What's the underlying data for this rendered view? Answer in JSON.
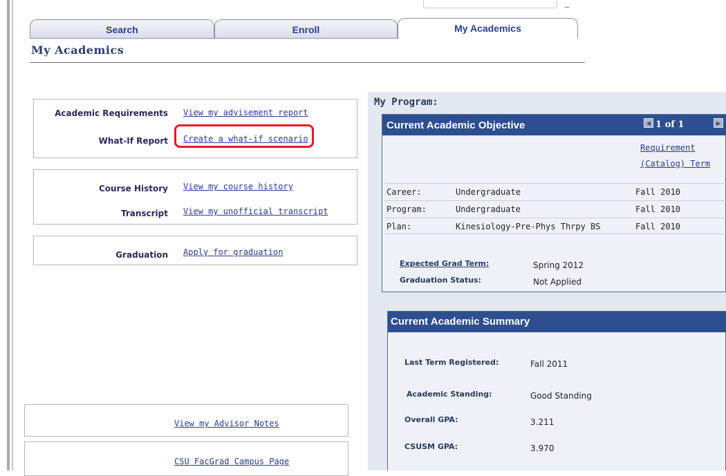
{
  "tabs": [
    {
      "label": "Search"
    },
    {
      "label": "Enroll"
    },
    {
      "label": "My Academics"
    }
  ],
  "page_title": "My Academics",
  "sections": {
    "academic_requirements": {
      "label": "Academic Requirements",
      "link": "View my advisement report"
    },
    "what_if": {
      "label": "What-If Report",
      "link": "Create a what-if scenario"
    },
    "course_history": {
      "label": "Course History",
      "link": "View my course history"
    },
    "transcript": {
      "label": "Transcript",
      "link": "View my unofficial transcript"
    },
    "graduation": {
      "label": "Graduation",
      "link": "Apply for graduation"
    }
  },
  "bottom_links": {
    "advisor_notes": "View my Advisor Notes",
    "campus_page": "CSU FacGrad Campus Page"
  },
  "program": {
    "title": "My Program:",
    "objective_header": "Current Academic Objective",
    "pager": "1 of 1",
    "req_term_line1": "Requirement",
    "req_term_line2": "(Catalog) Term",
    "rows": [
      {
        "label": "Career:",
        "value": "Undergraduate",
        "term": "Fall 2010"
      },
      {
        "label": "Program:",
        "value": "Undergraduate",
        "term": "Fall 2010"
      },
      {
        "label": "Plan:",
        "value": "Kinesiology-Pre-Phys Thrpy BS",
        "term": "Fall 2010"
      }
    ],
    "expected_grad_label": "Expected Grad Term:",
    "expected_grad_value": "Spring 2012",
    "grad_status_label": "Graduation Status:",
    "grad_status_value": "Not Applied"
  },
  "summary": {
    "header": "Current Academic Summary",
    "last_term_label": "Last Term Registered:",
    "last_term_value": "Fall 2011",
    "standing_label": "Academic Standing:",
    "standing_value": "Good Standing",
    "overall_gpa_label": "Overall GPA:",
    "overall_gpa_value": "3.211",
    "csusm_gpa_label": "CSUSM GPA:",
    "csusm_gpa_value": "3.970"
  },
  "colors": {
    "header_blue": "#2d4f8f",
    "link_blue": "#2b3a8f",
    "highlight_red": "#e8182a"
  }
}
